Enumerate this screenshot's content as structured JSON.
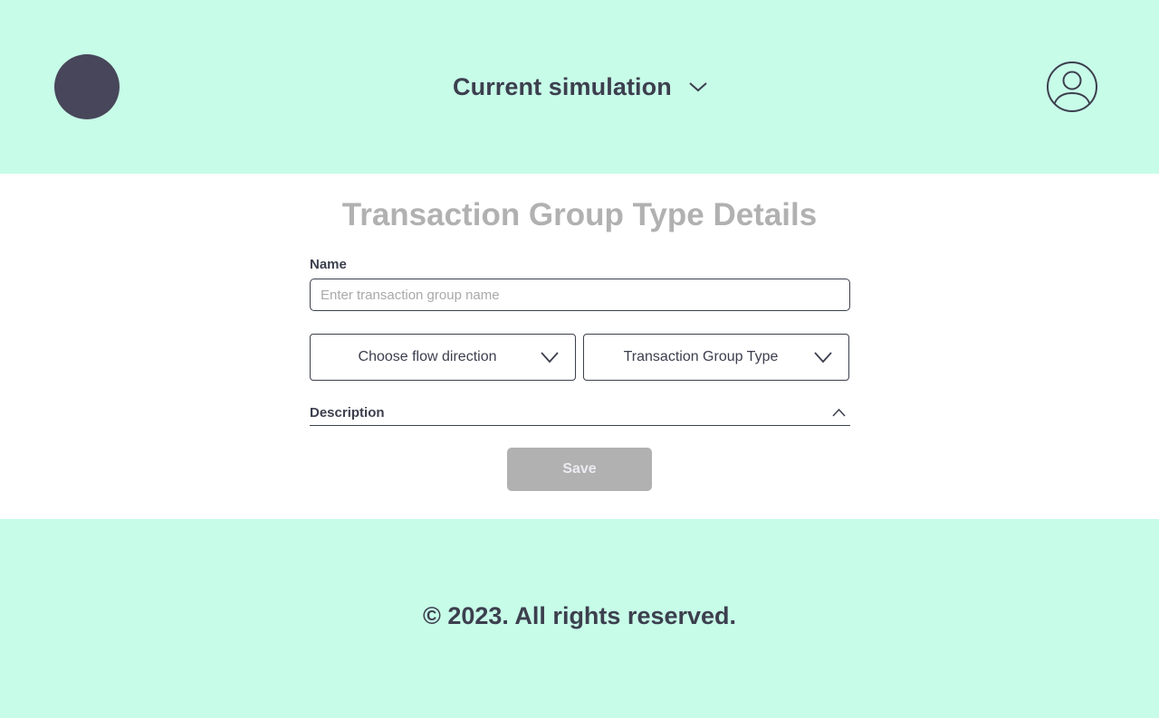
{
  "header": {
    "simulation_label": "Current simulation",
    "icons": {
      "logo": "logo-circle",
      "simulation_chevron": "chevron-down-icon",
      "user": "user-account-icon"
    }
  },
  "form": {
    "title": "Transaction Group Type Details",
    "name": {
      "label": "Name",
      "value": "",
      "placeholder": "Enter transaction group name"
    },
    "flow_direction": {
      "selected": "Choose flow direction"
    },
    "group_type": {
      "selected": "Transaction Group Type"
    },
    "description": {
      "label": "Description",
      "expanded": true
    },
    "save_label": "Save"
  },
  "footer": {
    "copyright": "© 2023. All rights reserved."
  },
  "colors": {
    "header_bg": "#c7fce8",
    "footer_bg": "#c7fce8",
    "text_dark": "#3c3f4e",
    "logo": "#48465a",
    "title_gray": "#b1b1b1",
    "button_disabled": "#b1b1b1"
  }
}
